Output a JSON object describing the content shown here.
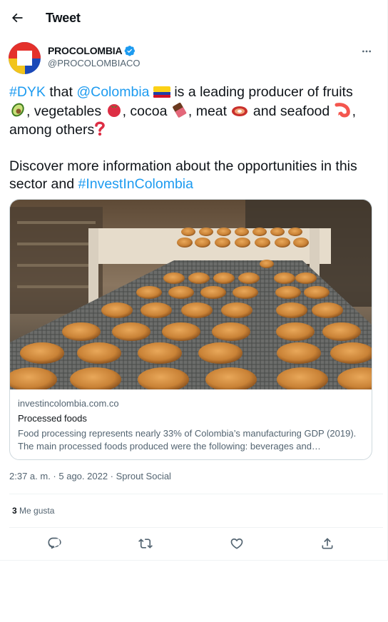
{
  "header": {
    "title": "Tweet",
    "back_icon": "arrow-left-icon"
  },
  "author": {
    "name": "PROCOLOMBIA",
    "handle": "@PROCOLOMBIACO",
    "verified_icon": "verified-badge-icon",
    "avatar_colors": [
      "#e4312b",
      "#f2c41b",
      "#1a49b8"
    ]
  },
  "more_icon": "more-horizontal-icon",
  "tweet": {
    "hashtag1": "#DYK",
    "t1": " that ",
    "mention": "@Colombia",
    "t2": " is a leading producer of fruits ",
    "t3": ", vegetables ",
    "t4": ", cocoa ",
    "t5": ", meat ",
    "t6": " and seafood ",
    "t7": ", among others",
    "p2": "Discover more information about the opportunities in this sector and ",
    "hashtag2": "#InvestInColombia",
    "emoji_names": [
      "colombia-flag-icon",
      "avocado-icon",
      "tomato-icon",
      "chocolate-bar-icon",
      "cut-of-meat-icon",
      "shrimp-icon",
      "question-mark-icon"
    ]
  },
  "card": {
    "domain": "investincolombia.com.co",
    "title": "Processed foods",
    "description": "Food processing represents nearly 33% of Colombia’s manufacturing GDP (2019). The main processed foods produced were the following: beverages and…"
  },
  "meta": {
    "time": "2:37 a. m.",
    "sep": " · ",
    "date": "5 ago. 2022",
    "source": "Sprout Social"
  },
  "stats": {
    "likes_count": "3",
    "likes_label": "Me gusta"
  },
  "actions": [
    "reply-icon",
    "retweet-icon",
    "like-icon",
    "share-icon"
  ],
  "colors": {
    "link": "#1d9bf0",
    "text": "#0f1419",
    "secondary": "#536471",
    "border": "#cfd9de"
  }
}
